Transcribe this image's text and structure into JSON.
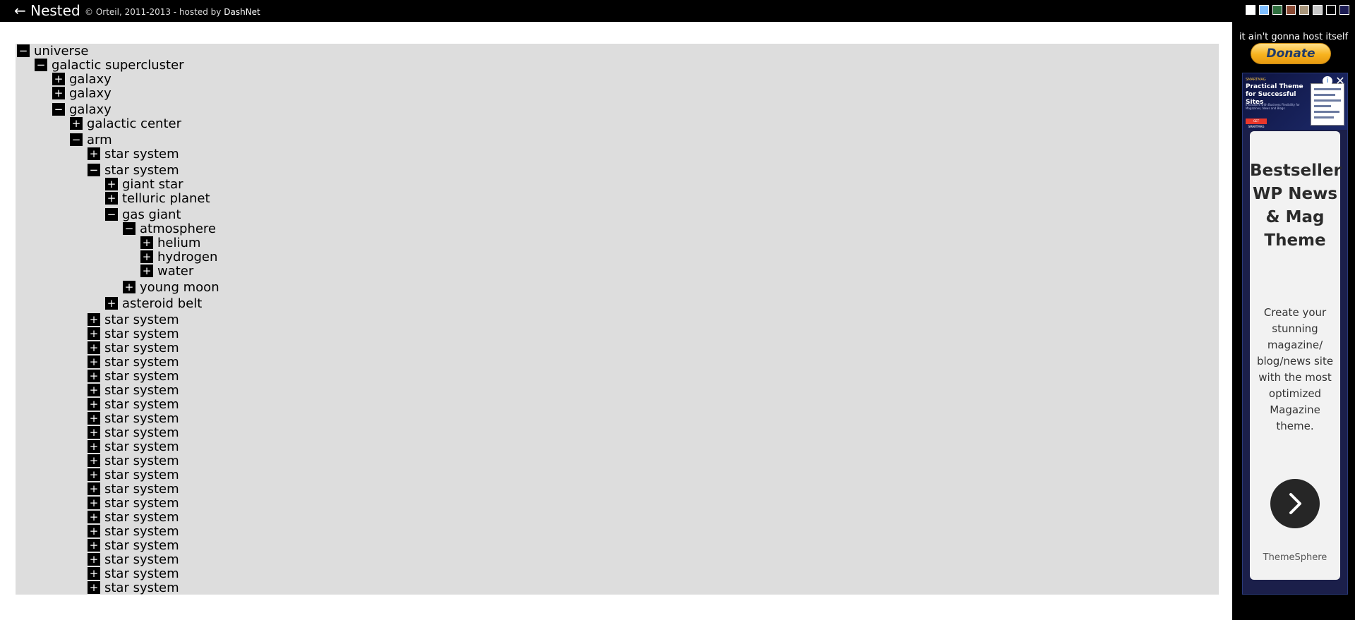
{
  "header": {
    "back_label": "← Nested",
    "credits_prefix": "© Orteil, 2011-2013 - hosted by",
    "credits_link": "DashNet"
  },
  "themes": [
    "#ffffff",
    "#7fbfff",
    "#2f6f3f",
    "#8a4b35",
    "#a8957a",
    "#c8c8c8",
    "#000000",
    "#1c1c54"
  ],
  "side": {
    "message": "it ain't gonna host itself",
    "donate_label": "Donate"
  },
  "ad": {
    "brand": "SMARTMAG",
    "banner_title": "Practical Theme for Successful Sites",
    "banner_desc": "Innovative with Business Flexibility for Magazines, News and Blogs",
    "banner_button": "GET SMARTMAG",
    "info_icon": "info-icon",
    "close_icon": "close-icon",
    "headline": "Bestseller WP News & Mag Theme",
    "description": "Create your stunning magazine/ blog/news site with the most optimized Magazine theme.",
    "arrow_icon": "chevron-right-icon",
    "advertiser": "ThemeSphere"
  },
  "tree": {
    "collapse_symbol": "−",
    "expand_symbol": "+",
    "root": {
      "label": "universe",
      "expanded": true,
      "children": [
        {
          "label": "galactic supercluster",
          "expanded": true,
          "children": [
            {
              "label": "galaxy",
              "expanded": false
            },
            {
              "label": "galaxy",
              "expanded": false
            },
            {
              "label": "galaxy",
              "expanded": true,
              "children": [
                {
                  "label": "galactic center",
                  "expanded": false
                },
                {
                  "label": "arm",
                  "expanded": true,
                  "children": [
                    {
                      "label": "star system",
                      "expanded": false
                    },
                    {
                      "label": "star system",
                      "expanded": true,
                      "children": [
                        {
                          "label": "giant star",
                          "expanded": false
                        },
                        {
                          "label": "telluric planet",
                          "expanded": false
                        },
                        {
                          "label": "gas giant",
                          "expanded": true,
                          "children": [
                            {
                              "label": "atmosphere",
                              "expanded": true,
                              "children": [
                                {
                                  "label": "helium",
                                  "expanded": false
                                },
                                {
                                  "label": "hydrogen",
                                  "expanded": false
                                },
                                {
                                  "label": "water",
                                  "expanded": false
                                }
                              ]
                            },
                            {
                              "label": "young moon",
                              "expanded": false
                            }
                          ]
                        },
                        {
                          "label": "asteroid belt",
                          "expanded": false
                        }
                      ]
                    },
                    {
                      "label": "star system",
                      "expanded": false
                    },
                    {
                      "label": "star system",
                      "expanded": false
                    },
                    {
                      "label": "star system",
                      "expanded": false
                    },
                    {
                      "label": "star system",
                      "expanded": false
                    },
                    {
                      "label": "star system",
                      "expanded": false
                    },
                    {
                      "label": "star system",
                      "expanded": false
                    },
                    {
                      "label": "star system",
                      "expanded": false
                    },
                    {
                      "label": "star system",
                      "expanded": false
                    },
                    {
                      "label": "star system",
                      "expanded": false
                    },
                    {
                      "label": "star system",
                      "expanded": false
                    },
                    {
                      "label": "star system",
                      "expanded": false
                    },
                    {
                      "label": "star system",
                      "expanded": false
                    },
                    {
                      "label": "star system",
                      "expanded": false
                    },
                    {
                      "label": "star system",
                      "expanded": false
                    },
                    {
                      "label": "star system",
                      "expanded": false
                    },
                    {
                      "label": "star system",
                      "expanded": false
                    },
                    {
                      "label": "star system",
                      "expanded": false
                    },
                    {
                      "label": "star system",
                      "expanded": false
                    },
                    {
                      "label": "star system",
                      "expanded": false
                    },
                    {
                      "label": "star system",
                      "expanded": false
                    }
                  ]
                }
              ]
            }
          ]
        }
      ]
    }
  }
}
